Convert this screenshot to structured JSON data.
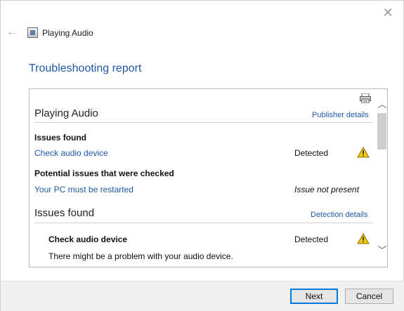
{
  "window": {
    "title": "Playing Audio",
    "close_glyph": "✕",
    "back_glyph": "←"
  },
  "heading": "Troubleshooting report",
  "report": {
    "section1": {
      "title": "Playing Audio",
      "link": "Publisher details",
      "issues_found_label": "Issues found",
      "issue": {
        "name": "Check audio device",
        "status": "Detected"
      },
      "potential_label": "Potential issues that were checked",
      "potential": {
        "name": "Your PC must be restarted",
        "status": "Issue not present"
      }
    },
    "section2": {
      "title": "Issues found",
      "link": "Detection details",
      "issue": {
        "name": "Check audio device",
        "status": "Detected",
        "description": "There might be a problem with your audio device."
      }
    },
    "scroll": {
      "up_glyph": "︿",
      "down_glyph": "﹀"
    }
  },
  "footer": {
    "next_label": "Next",
    "cancel_label": "Cancel"
  },
  "colors": {
    "link": "#1e5aa6",
    "warning": "#f2c811",
    "accent": "#0078d7"
  },
  "icons": [
    "back-arrow-icon",
    "close-icon",
    "troubleshooter-icon",
    "print-icon",
    "warning-icon",
    "chevron-up-icon",
    "chevron-down-icon"
  ]
}
